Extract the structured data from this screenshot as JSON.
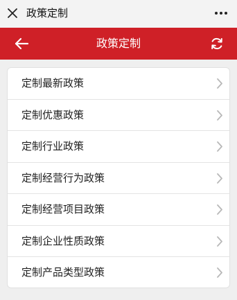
{
  "window": {
    "title": "政策定制",
    "close_icon": "close-icon",
    "more_icon": "more-dots-icon"
  },
  "header": {
    "title": "政策定制",
    "back_icon": "arrow-left-icon",
    "refresh_icon": "refresh-icon",
    "accent_color": "#cf2027"
  },
  "menu": {
    "items": [
      {
        "label": "定制最新政策",
        "icon": "chevron-right-icon"
      },
      {
        "label": "定制优惠政策",
        "icon": "chevron-right-icon"
      },
      {
        "label": "定制行业政策",
        "icon": "chevron-right-icon"
      },
      {
        "label": "定制经营行为政策",
        "icon": "chevron-right-icon"
      },
      {
        "label": "定制经营项目政策",
        "icon": "chevron-right-icon"
      },
      {
        "label": "定制企业性质政策",
        "icon": "chevron-right-icon"
      },
      {
        "label": "定制产品类型政策",
        "icon": "chevron-right-icon"
      }
    ]
  }
}
